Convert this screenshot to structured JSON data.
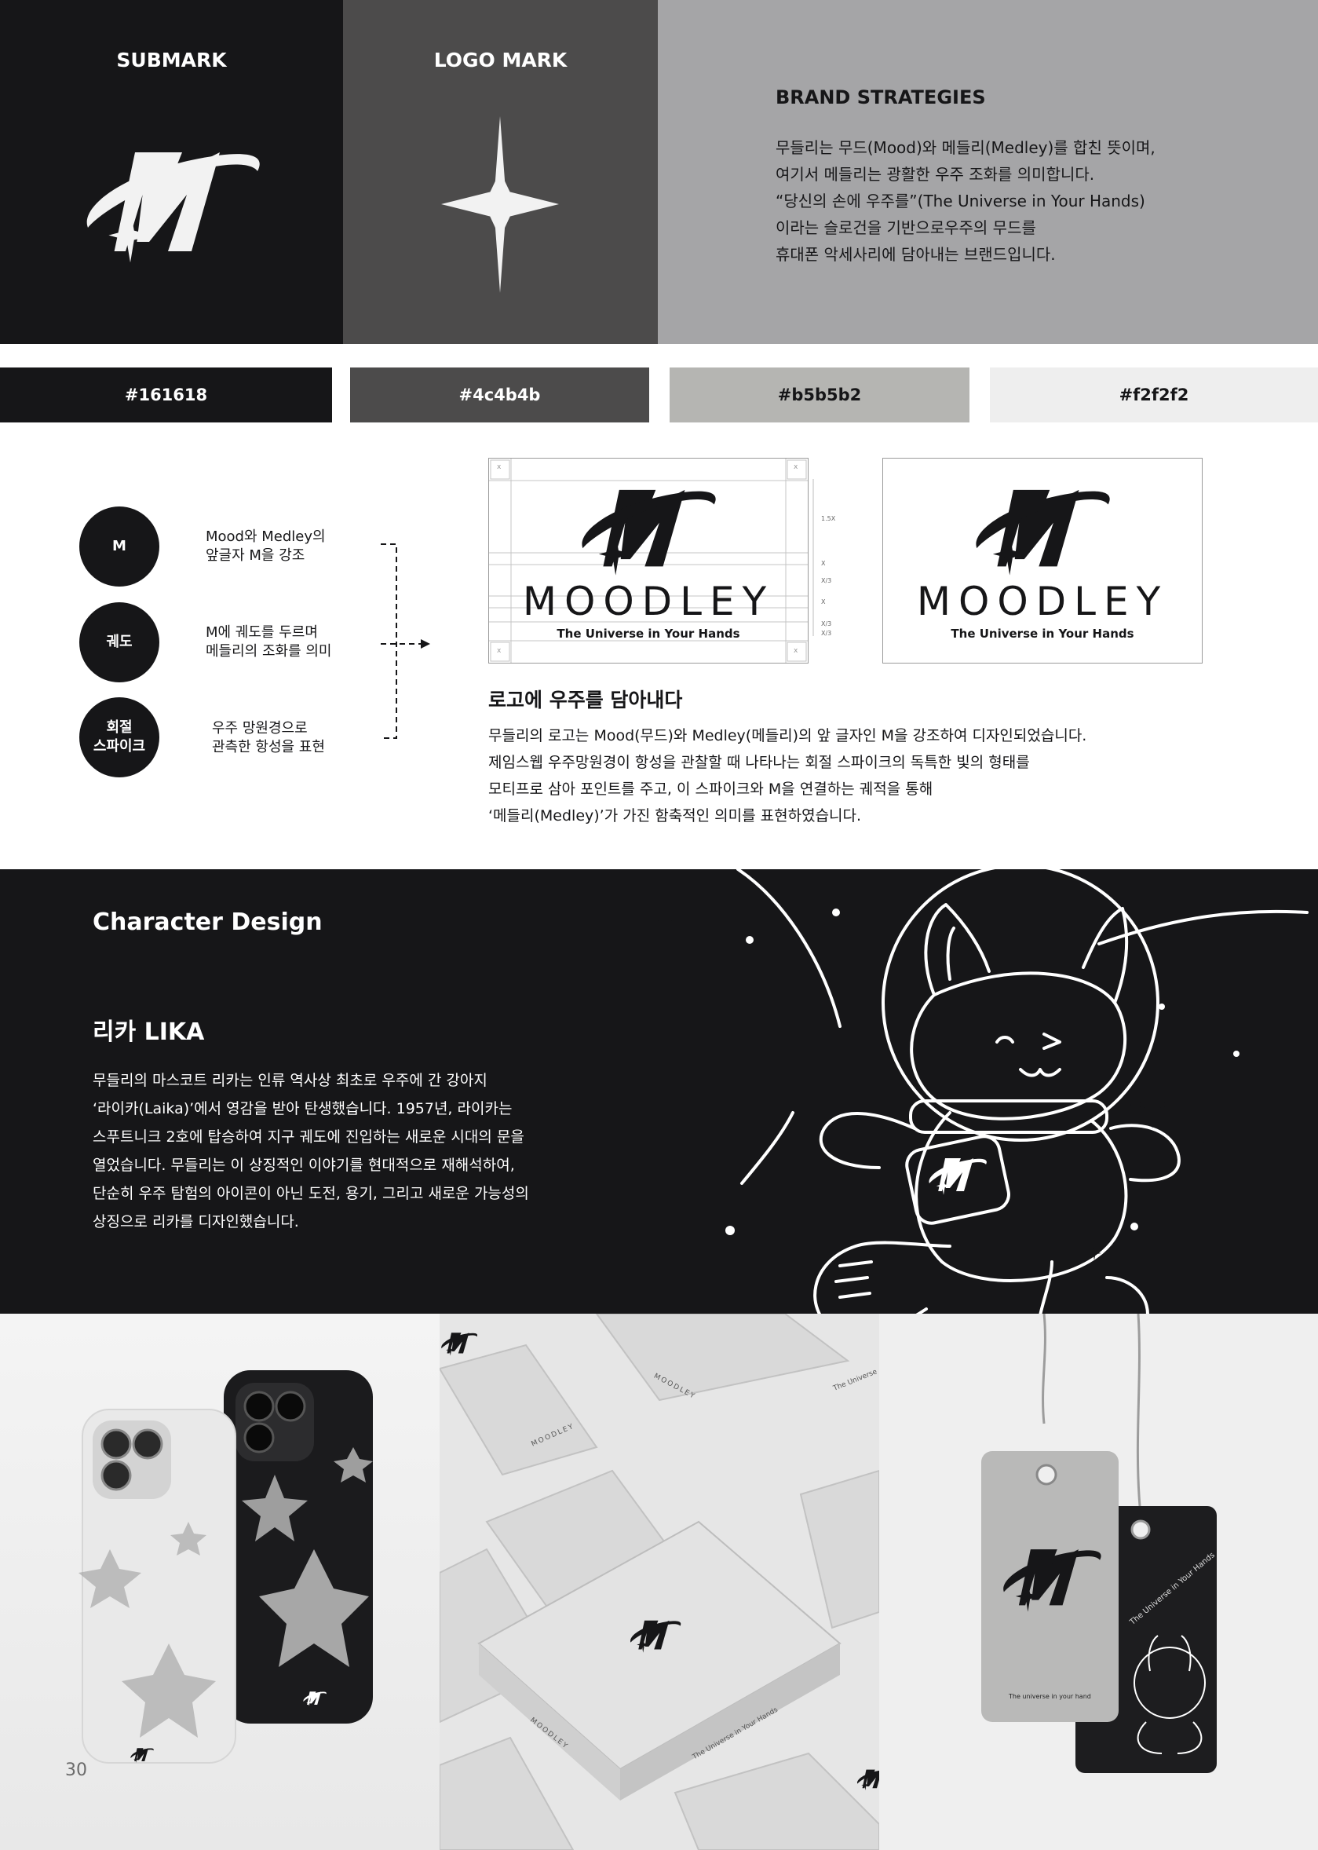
{
  "panels": {
    "submark": "SUBMARK",
    "logomark": "LOGO MARK",
    "strategies_title": "BRAND STRATEGIES",
    "strategies_lines": [
      "무들리는 무드(Mood)와 메들리(Medley)를 합친 뜻이며,",
      "여기서 메들리는 광활한 우주 조화를 의미합니다.",
      "“당신의 손에 우주를”(The Universe in Your Hands)",
      "이라는 슬로건을 기반으로우주의 무드를",
      "휴대폰 악세사리에 담아내는 브랜드입니다."
    ]
  },
  "colors": {
    "c1": "#161618",
    "c2": "#4c4b4b",
    "c3": "#b5b5b2",
    "c4": "#f2f2f2"
  },
  "concept": {
    "items": [
      {
        "circle": "M",
        "label": [
          "Mood와 Medley의",
          "앞글자 M을 강조"
        ]
      },
      {
        "circle": "궤도",
        "label": [
          "M에 궤도를 두르며",
          "메들리의 조화를 의미"
        ]
      },
      {
        "circle_lines": [
          "회절",
          "스파이크"
        ],
        "label": [
          "우주 망원경으로",
          "관측한 항성을 표현"
        ]
      }
    ]
  },
  "logo": {
    "wordmark": "MOODLEY",
    "tagline": "The Universe in Your Hands",
    "guide_labels": [
      "1.5X",
      "X",
      "X/3",
      "X",
      "X/3",
      "X/3"
    ],
    "corner_mark": "x",
    "heading": "로고에 우주를 담아내다",
    "desc_lines": [
      "무들리의 로고는 Mood(무드)와 Medley(메들리)의 앞 글자인 M을 강조하여 디자인되었습니다.",
      "제임스웹 우주망원경이 항성을 관찰할 때 나타나는 회절 스파이크의 독특한 빛의 형태를",
      "모티프로 삼아 포인트를 주고, 이 스파이크와 M을 연결하는 궤적을 통해",
      "‘메들리(Medley)’가 가진 함축적인 의미를 표현하였습니다."
    ]
  },
  "character": {
    "section_title": "Character Design",
    "name": "리카 LIKA",
    "desc_lines": [
      "무들리의 마스코트 리카는 인류 역사상 최초로 우주에 간 강아지",
      "‘라이카(Laika)’에서 영감을 받아 탄생했습니다. 1957년, 라이카는",
      "스푸트니크 2호에 탑승하여 지구 궤도에 진입하는 새로운 시대의 문을",
      "열었습니다. 무들리는 이 상징적인 이야기를 현대적으로 재해석하여,",
      "단순히 우주 탐험의 아이콘이 아닌 도전, 용기, 그리고 새로운 가능성의",
      "상징으로 리카를 디자인했습니다."
    ]
  },
  "mockups": {
    "box_brand": "MOODLEY",
    "box_tagline": "The Universe in Your Hands",
    "box_tagline_short": "The Universe",
    "tag_text": "The universe in your hand",
    "tag_arc": "The Universe in Your Hands"
  },
  "page_number": "30"
}
